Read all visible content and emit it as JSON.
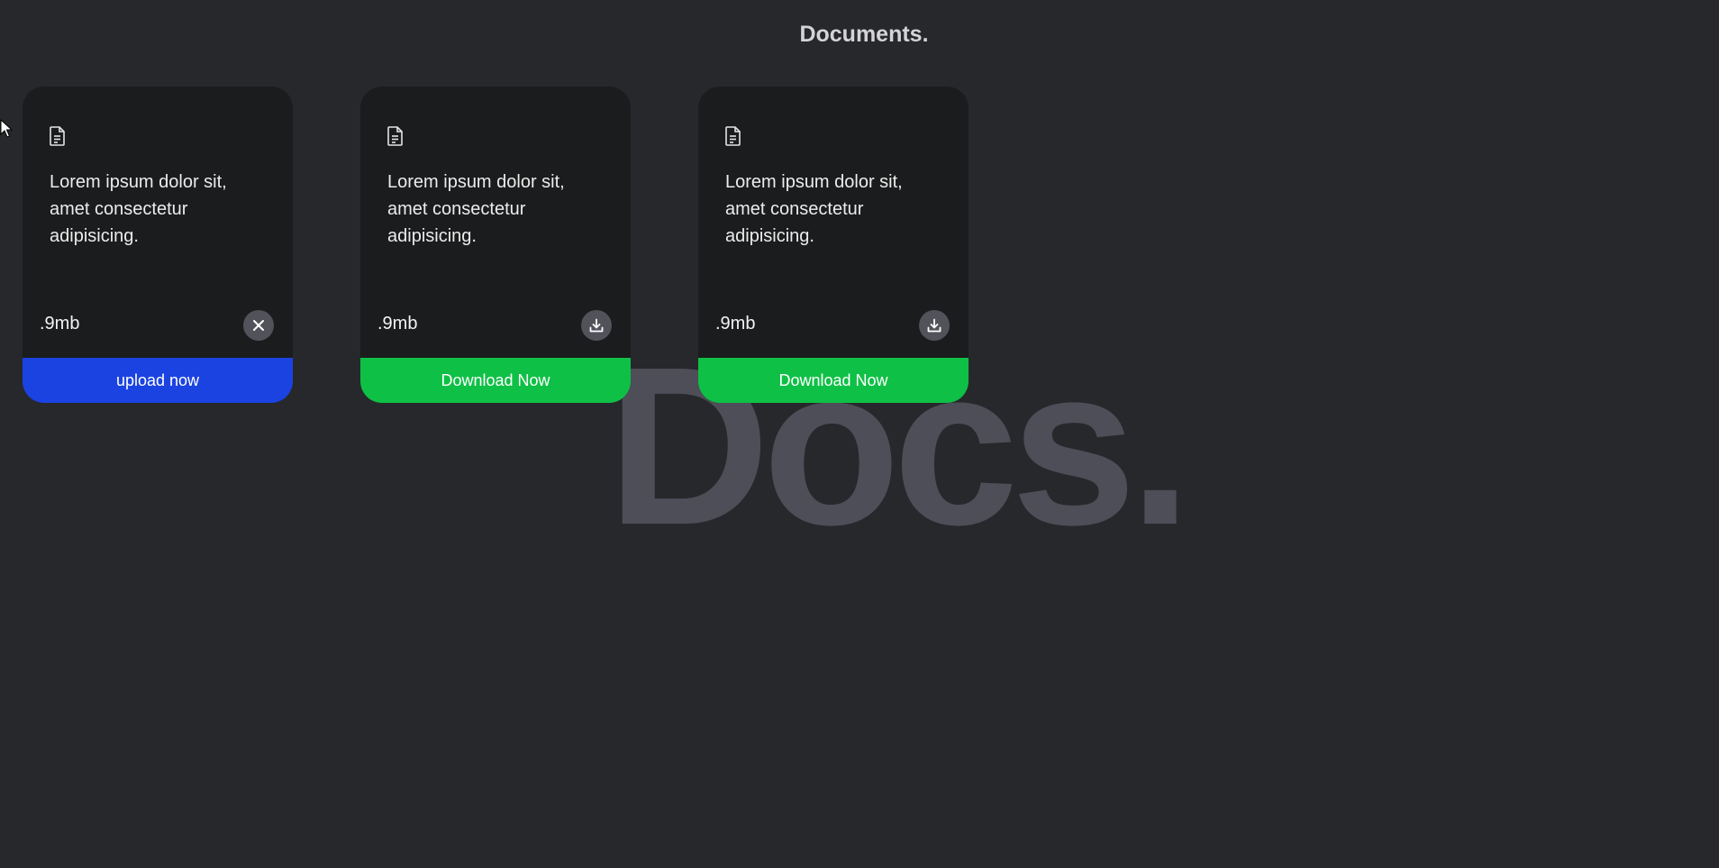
{
  "header": {
    "title": "Documents."
  },
  "watermark": "Docs.",
  "cards": [
    {
      "icon": "document-icon",
      "text": "Lorem ipsum dolor sit, amet consectetur adipisicing.",
      "size": ".9mb",
      "action_icon": "close-icon",
      "button_label": "upload now",
      "button_color": "#1b43e2"
    },
    {
      "icon": "document-icon",
      "text": "Lorem ipsum dolor sit, amet consectetur adipisicing.",
      "size": ".9mb",
      "action_icon": "download-icon",
      "button_label": "Download Now",
      "button_color": "#0fc046"
    },
    {
      "icon": "document-icon",
      "text": "Lorem ipsum dolor sit, amet consectetur adipisicing.",
      "size": ".9mb",
      "action_icon": "download-icon",
      "button_label": "Download Now",
      "button_color": "#0fc046"
    }
  ],
  "colors": {
    "background": "#27282b",
    "card": "#1b1c1d",
    "watermark": "#4d4e58",
    "action_circle": "#52535a"
  }
}
